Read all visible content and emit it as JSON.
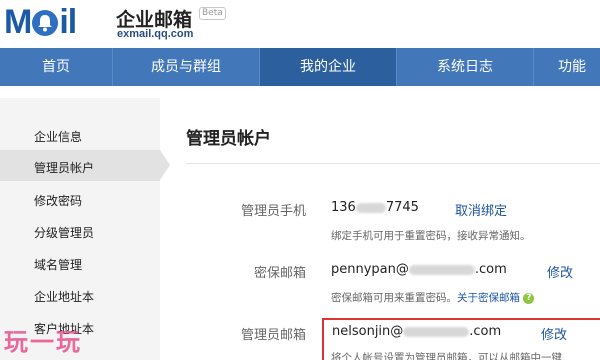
{
  "header": {
    "logo_text_left": "M",
    "logo_text_right": "il",
    "brand_name": "企业邮箱",
    "beta_label": "Beta",
    "brand_url": "exmail.qq.com"
  },
  "nav": {
    "items": [
      {
        "label": "首页"
      },
      {
        "label": "成员与群组"
      },
      {
        "label": "我的企业",
        "active": true
      },
      {
        "label": "系统日志"
      },
      {
        "label": "功能"
      }
    ]
  },
  "sidebar": {
    "items": [
      {
        "label": "企业信息"
      },
      {
        "label": "管理员帐户",
        "active": true
      },
      {
        "label": "修改密码"
      },
      {
        "label": "分级管理员"
      },
      {
        "label": "域名管理"
      },
      {
        "label": "企业地址本"
      },
      {
        "label": "客户地址本"
      }
    ]
  },
  "main": {
    "title": "管理员帐户",
    "phone": {
      "label": "管理员手机",
      "value_prefix": "136",
      "value_suffix": "7745",
      "action": "取消绑定",
      "hint": "绑定手机可用于重置密码，接收异常通知。"
    },
    "security_email": {
      "label": "密保邮箱",
      "value_prefix": "pennypan@",
      "value_suffix": ".com",
      "action": "修改",
      "hint": "密保邮箱可用来重置密码。",
      "hint_link": "关于密保邮箱",
      "help_icon": "?"
    },
    "admin_email": {
      "label": "管理员邮箱",
      "value_prefix": "nelsonjin@",
      "value_suffix": ".com",
      "action": "修改",
      "hint": "将个人帐号设置为管理员邮箱，可以从邮箱中一键"
    }
  },
  "watermark": "玩一玩",
  "colors": {
    "nav_bg": "#4277b9",
    "nav_active": "#2b5f9e",
    "link": "#1e56a0",
    "highlight": "#e0322f"
  }
}
